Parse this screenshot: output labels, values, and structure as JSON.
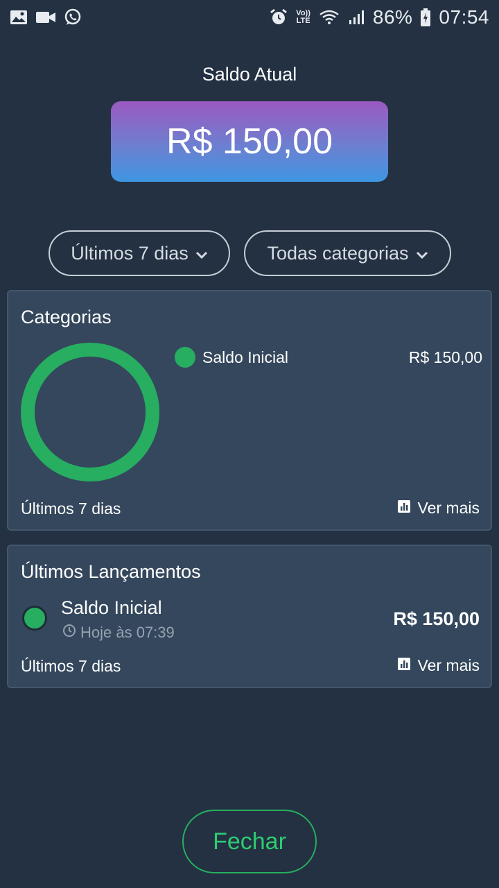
{
  "status_bar": {
    "battery": "86%",
    "time": "07:54",
    "lte_top": "Vo))",
    "lte_bottom": "LTE"
  },
  "balance": {
    "label": "Saldo Atual",
    "amount": "R$ 150,00"
  },
  "filters": {
    "period": "Últimos 7 dias",
    "category": "Todas categorias"
  },
  "categories_card": {
    "title": "Categorias",
    "legend": [
      {
        "name": "Saldo Inicial",
        "value": "R$ 150,00",
        "color": "#27ae60"
      }
    ],
    "footer_period": "Últimos 7 dias",
    "see_more": "Ver mais"
  },
  "launches_card": {
    "title": "Últimos Lançamentos",
    "entries": [
      {
        "name": "Saldo Inicial",
        "time": "Hoje às 07:39",
        "amount": "R$ 150,00",
        "color": "#27ae60"
      }
    ],
    "footer_period": "Últimos 7 dias",
    "see_more": "Ver mais"
  },
  "close_button": "Fechar",
  "colors": {
    "background": "#233142",
    "card": "#34475c",
    "accent_green": "#27ae60",
    "gradient_top": "#9b59c0",
    "gradient_bottom": "#3f96e2"
  }
}
